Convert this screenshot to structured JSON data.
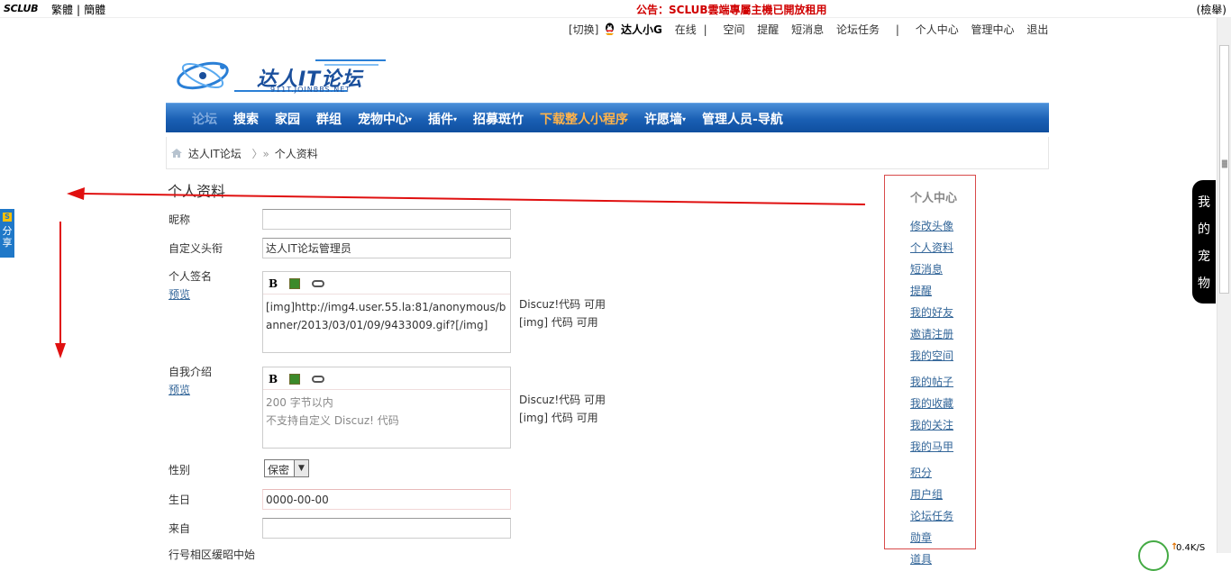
{
  "topbar": {
    "logo": "SCLUB",
    "lang_trad": "繁體",
    "lang_simp": "簡體",
    "announcement": "公告：SCLUB雲端專屬主機已開放租用",
    "login": "(檢舉)"
  },
  "usernav": {
    "switch": "[切换]",
    "username": "达人小G",
    "online": "在线",
    "items": [
      "空间",
      "提醒",
      "短消息",
      "论坛任务",
      "|",
      "个人中心",
      "管理中心",
      "退出"
    ]
  },
  "logo": {
    "title": "达人IT论坛",
    "subtitle": "911T.JOINBBS.NET"
  },
  "mainnav": {
    "items": [
      {
        "label": "论坛",
        "style": "dim"
      },
      {
        "label": "搜索",
        "style": ""
      },
      {
        "label": "家园",
        "style": ""
      },
      {
        "label": "群组",
        "style": ""
      },
      {
        "label": "宠物中心",
        "style": "",
        "dropdown": true
      },
      {
        "label": "插件",
        "style": "",
        "dropdown": true
      },
      {
        "label": "招募斑竹",
        "style": ""
      },
      {
        "label": "下载整人小程序",
        "style": "hl"
      },
      {
        "label": "许愿墙",
        "style": "",
        "dropdown": true
      },
      {
        "label": "管理人员-导航",
        "style": ""
      }
    ]
  },
  "breadcrumb": {
    "home": "达人IT论坛",
    "sep": "〉»",
    "current": "个人资料"
  },
  "page": {
    "title": "个人资料"
  },
  "form": {
    "nickname": {
      "label": "昵称",
      "value": ""
    },
    "custom_title": {
      "label": "自定义头衔",
      "value": "达人IT论坛管理员"
    },
    "signature": {
      "label": "个人签名",
      "preview": "预览",
      "content": "[img]http://img4.user.55.la:81/anonymous/banner/2013/03/01/09/9433009.gif?[/img]",
      "hint1": "Discuz!代码 可用",
      "hint2": "[img] 代码 可用"
    },
    "intro": {
      "label": "自我介绍",
      "preview": "预览",
      "placeholder1": "200 字节以内",
      "placeholder2": "不支持自定义 Discuz! 代码",
      "hint1": "Discuz!代码 可用",
      "hint2": "[img] 代码 可用"
    },
    "gender": {
      "label": "性别",
      "value": "保密"
    },
    "birthday": {
      "label": "生日",
      "value": "0000-00-00"
    },
    "from": {
      "label": "来自",
      "value": ""
    },
    "cut_label": "行号相区缓昭中始"
  },
  "editor_toolbar": {
    "bold": "B"
  },
  "sidebar": {
    "title": "个人中心",
    "group1": [
      "修改头像",
      "个人资料",
      "短消息",
      "提醒",
      "我的好友",
      "邀请注册",
      "我的空间"
    ],
    "group2": [
      "我的帖子",
      "我的收藏",
      "我的关注",
      "我的马甲"
    ],
    "group3": [
      "积分",
      "用户组",
      "论坛任务",
      "勋章",
      "道具"
    ]
  },
  "share_tab": {
    "badge": "S",
    "label": "分享"
  },
  "pet_tab": {
    "chars": [
      "我",
      "的",
      "宠",
      "物"
    ]
  },
  "netspeed": {
    "value": "0.4K/S",
    "arrow": "↑"
  },
  "colors": {
    "nav_blue": "#1a5fb4",
    "nav_highlight": "#ffb34a",
    "annotation_red": "#e01010",
    "link_blue": "#336699",
    "announce_red": "#d00000"
  }
}
